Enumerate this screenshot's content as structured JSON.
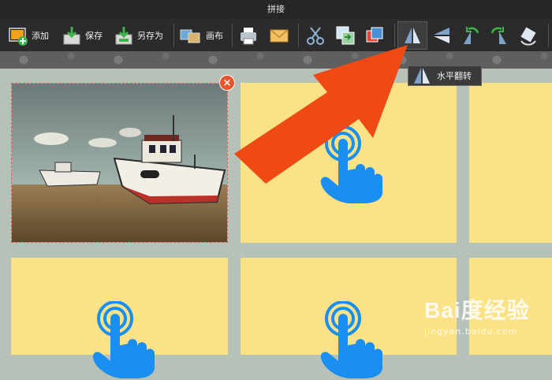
{
  "window": {
    "title": "拼接"
  },
  "toolbar": {
    "add_label": "添加",
    "save_label": "保存",
    "save_as_label": "另存为",
    "canvas_label": "画布"
  },
  "tooltip": {
    "label": "水平翻转"
  },
  "photo_close": "×",
  "watermark": {
    "brand": "Bai度经验",
    "url": "jingyan.baidu.com"
  },
  "colors": {
    "tile": "#fce287",
    "hand": "#1a8ff0",
    "arrow": "#f04a14",
    "canvas": "#b6c2b8"
  }
}
